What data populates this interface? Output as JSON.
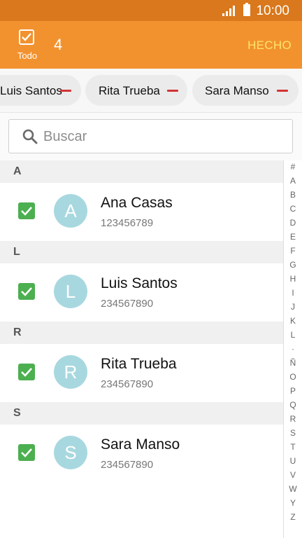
{
  "status_bar": {
    "time": "10:00",
    "signal_icon": "signal-icon",
    "battery_icon": "battery-icon"
  },
  "action_bar": {
    "select_all_label": "Todo",
    "selected_count": "4",
    "done_label": "HECHO",
    "colors": {
      "background": "#f2922f",
      "status": "#d9781c",
      "done": "#ffe56a"
    }
  },
  "chips": [
    {
      "name": "Luis Santos"
    },
    {
      "name": "Rita Trueba"
    },
    {
      "name": "Sara Manso"
    }
  ],
  "search": {
    "placeholder": "Buscar",
    "icon": "search-icon"
  },
  "sections": [
    {
      "letter": "A",
      "contacts": [
        {
          "initial": "A",
          "name": "Ana Casas",
          "number": "123456789",
          "checked": true
        }
      ]
    },
    {
      "letter": "L",
      "contacts": [
        {
          "initial": "L",
          "name": "Luis Santos",
          "number": "234567890",
          "checked": true
        }
      ]
    },
    {
      "letter": "R",
      "contacts": [
        {
          "initial": "R",
          "name": "Rita Trueba",
          "number": "234567890",
          "checked": true
        }
      ]
    },
    {
      "letter": "S",
      "contacts": [
        {
          "initial": "S",
          "name": "Sara Manso",
          "number": "234567890",
          "checked": true
        }
      ]
    }
  ],
  "index_letters": [
    "#",
    "A",
    "B",
    "C",
    "D",
    "E",
    "F",
    "G",
    "H",
    "I",
    "J",
    "K",
    "L",
    "·",
    "Ñ",
    "O",
    "P",
    "Q",
    "R",
    "S",
    "T",
    "U",
    "V",
    "W",
    "Y",
    "Z"
  ]
}
